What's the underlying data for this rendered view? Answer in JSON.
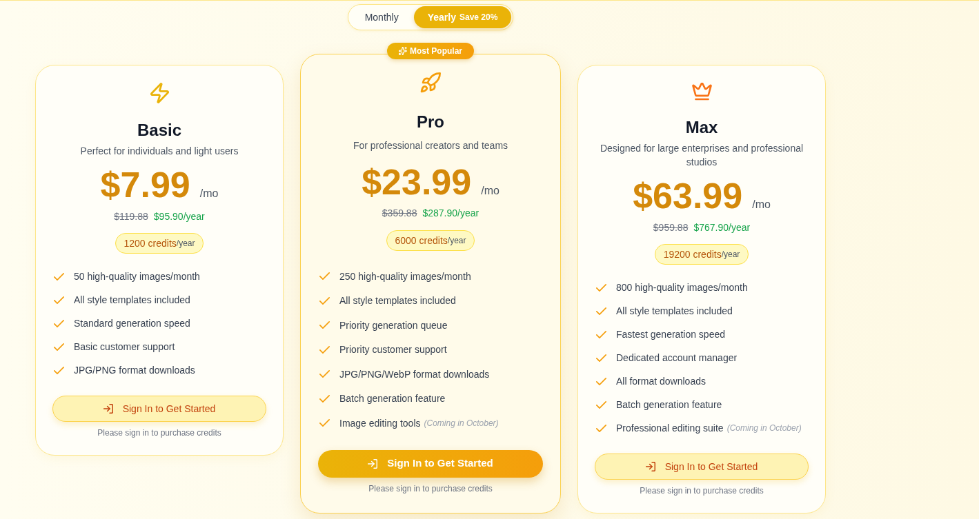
{
  "billing_toggle": [
    {
      "label": "Monthly",
      "selected": false
    },
    {
      "label": "Yearly",
      "badge": "Save 20%",
      "selected": true
    }
  ],
  "plans": [
    {
      "name": "Basic",
      "highlighted": false,
      "description": "Perfect for individuals and light users",
      "price": "$7.99",
      "period": "/mo",
      "original_price": "$119.88",
      "discounted_price": "$95.90/year",
      "credits": "1200 credits",
      "credits_period": "/year",
      "features": [
        {
          "text": "50 high-quality images/month"
        },
        {
          "text": "All style templates included"
        },
        {
          "text": "Standard generation speed"
        },
        {
          "text": "Basic customer support"
        },
        {
          "text": "JPG/PNG format downloads"
        }
      ],
      "button": "Sign In to Get Started",
      "footnote": "Please sign in to purchase credits"
    },
    {
      "name": "Pro",
      "badge": "Most Popular",
      "highlighted": true,
      "description": "For professional creators and teams",
      "price": "$23.99",
      "period": "/mo",
      "original_price": "$359.88",
      "discounted_price": "$287.90/year",
      "credits": "6000 credits",
      "credits_period": "/year",
      "features": [
        {
          "text": "250 high-quality images/month"
        },
        {
          "text": "All style templates included"
        },
        {
          "text": "Priority generation queue"
        },
        {
          "text": "Priority customer support"
        },
        {
          "text": "JPG/PNG/WebP format downloads"
        },
        {
          "text": "Batch generation feature"
        },
        {
          "text": "Image editing tools",
          "note": "(Coming in October)"
        }
      ],
      "button": "Sign In to Get Started",
      "footnote": "Please sign in to purchase credits"
    },
    {
      "name": "Max",
      "highlighted": false,
      "description": "Designed for large enterprises and professional studios",
      "price": "$63.99",
      "period": "/mo",
      "original_price": "$959.88",
      "discounted_price": "$767.90/year",
      "credits": "19200 credits",
      "credits_period": "/year",
      "features": [
        {
          "text": "800 high-quality images/month"
        },
        {
          "text": "All style templates included"
        },
        {
          "text": "Fastest generation speed"
        },
        {
          "text": "Dedicated account manager"
        },
        {
          "text": "All format downloads"
        },
        {
          "text": "Batch generation feature"
        },
        {
          "text": "Professional editing suite",
          "note": "(Coming in October)"
        }
      ],
      "button": "Sign In to Get Started",
      "footnote": "Please sign in to purchase credits"
    }
  ]
}
